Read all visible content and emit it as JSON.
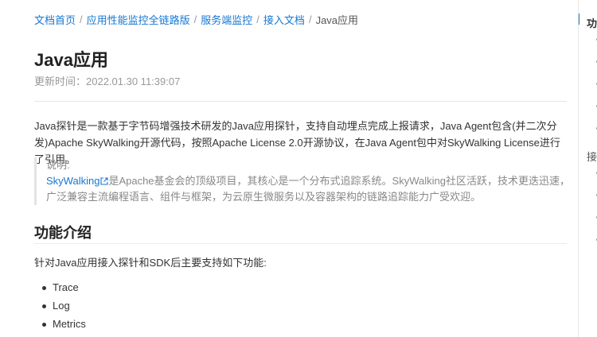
{
  "breadcrumb": {
    "items": [
      "文档首页",
      "应用性能监控全链路版",
      "服务端监控",
      "接入文档"
    ],
    "separator": "/",
    "current": "Java应用"
  },
  "article": {
    "title": "Java应用",
    "updated": "更新时间：2022.01.30 11:39:07",
    "intro": "Java探针是一款基于字节码增强技术研发的Java应用探针，支持自动埋点完成上报请求，Java Agent包含(并二次分发)Apache SkyWalking开源代码，按照Apache License 2.0开源协议，在Java Agent包中对SkyWalking License进行了引用。",
    "note": {
      "label": "说明:",
      "link_text": "SkyWalking",
      "text": "是Apache基金会的顶级项目，其核心是一个分布式追踪系统。SkyWalking社区活跃，技术更迭迅速，广泛兼容主流编程语言、组件与框架，为云原生微服务以及容器架构的链路追踪能力广受欢迎。"
    },
    "section": {
      "title": "功能介绍",
      "description": "针对Java应用接入探针和SDK后主要支持如下功能:",
      "features": [
        "Trace",
        "Log",
        "Metrics"
      ]
    }
  },
  "toc": {
    "title": "功",
    "item": "接"
  },
  "colors": {
    "link": "#1677d2",
    "text": "#333333",
    "muted": "#999999"
  }
}
